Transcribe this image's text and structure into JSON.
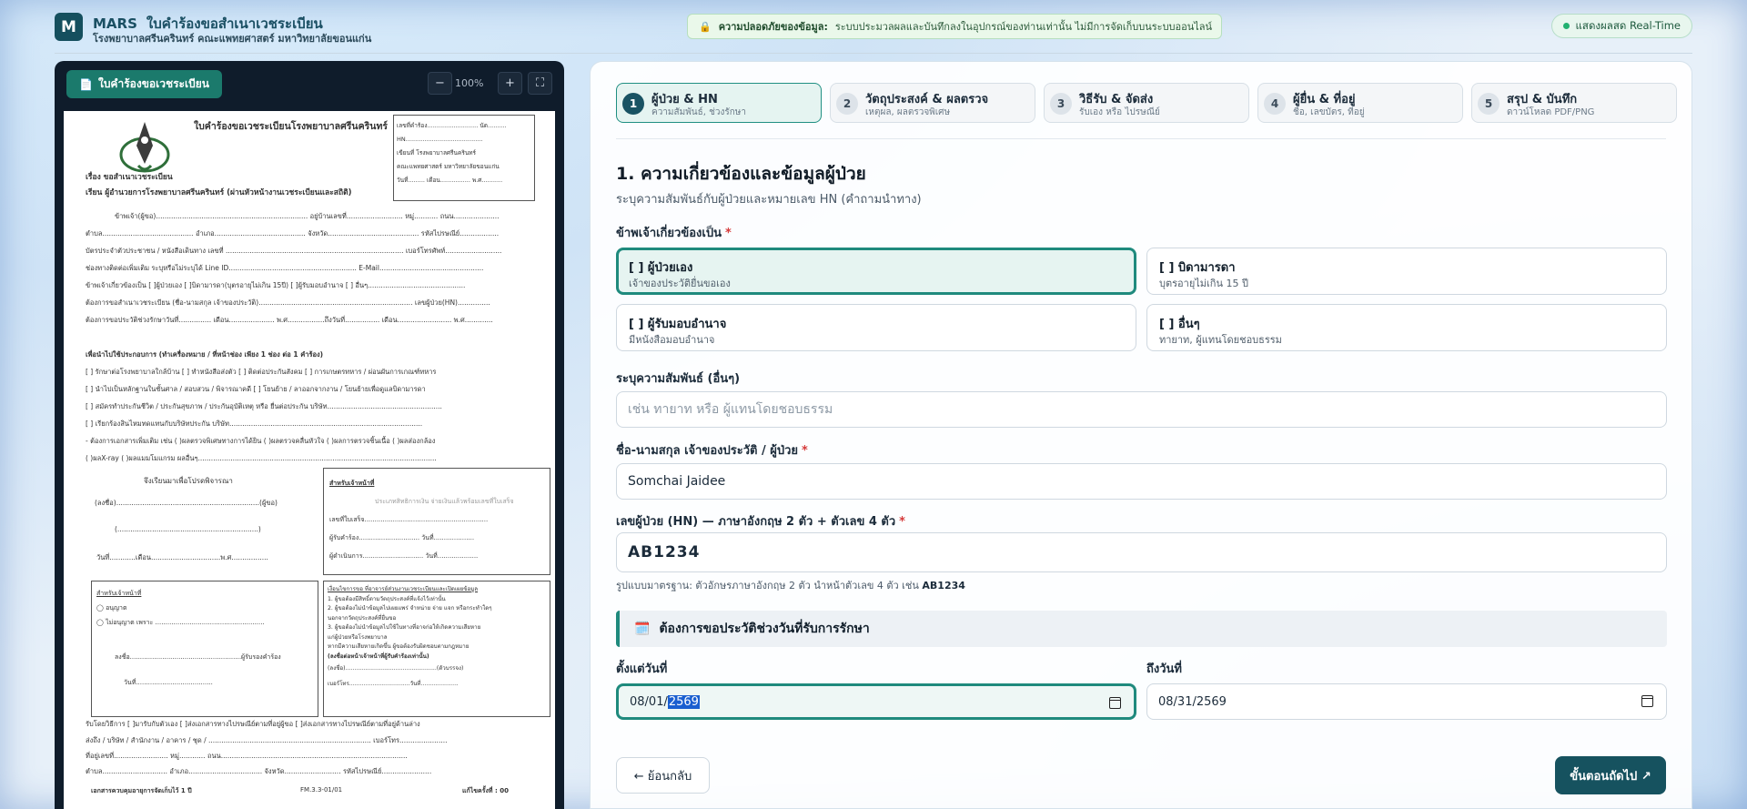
{
  "header": {
    "logo": "M",
    "app_name": "MARS",
    "app_title": "ใบคำร้องขอสำเนาเวชระเบียน",
    "app_sub": "โรงพยาบาลศรีนครินทร์ คณะแพทยศาสตร์ มหาวิทยาลัยขอนแก่น",
    "privacy_title": "ความปลอดภัยของข้อมูล:",
    "privacy_text": "ระบบประมวลผลและบันทึกลงในอุปกรณ์ของท่านเท่านั้น ไม่มีการจัดเก็บบนระบบออนไลน์",
    "realtime": "แสดงผลสด Real-Time",
    "accent": "#1f8a7d",
    "brand": "#16525f"
  },
  "preview": {
    "form_button": "ใบคำร้องขอเวชระเบียน",
    "zoom_out": "−",
    "zoom_level": "100%",
    "zoom_in": "+",
    "fullscreen": "⛶",
    "doc": {
      "heading": "ใบคำร้องขอเวชระเบียนโรงพยาบาลศรีนครินทร์",
      "box_lines": [
        "เลขที่คำร้อง........................... นัด..........",
        "HN.........................................",
        "เขียนที่  โรงพยาบาลศรีนครินทร์",
        "คณะแพทยศาสตร์ มหาวิทยาลัยขอนแก่น",
        "วันที่......... เดือน................ พ.ศ..........."
      ],
      "subject": "เรื่อง      ขอสำเนาเวชระเบียน",
      "to": "เรียน      ผู้อำนวยการโรงพยาบาลศรีนครินทร์ (ผ่านหัวหน้างานเวชระเบียนและสถิติ)",
      "lines": [
        "ข้าพเจ้า(ผู้ขอ)...................................................................... อยู่บ้านเลขที่.......................... หมู่........... ถนน.....................",
        "ตำบล.......................................... อำเภอ.......................................... จังหวัด.......................................... รหัสไปรษณีย์..................",
        "บัตรประจำตัวประชาชน / หนังสือเดินทาง เลขที่ .................................................................................. เบอร์โทรศัพท์..........................",
        "ช่องทางติดต่อเพิ่มเติม ระบุหรือไม่ระบุได้ Line ID........................................................... E-Mail................................................",
        "ข้าพเจ้าเกี่ยวข้องเป็น  [ ]ผู้ป่วยเอง  [ ]บิดามารดา(บุตรอายุไม่เกิน 15ปี)  [ ]ผู้รับมอบอำนาจ  [ ] อื่นๆ.............................................",
        "ต้องการขอสำเนาเวชระเบียน (ชื่อ-นามสกุล เจ้าของประวัติ)....................................................................... เลขผู้ป่วย(HN)...............",
        "ต้องการขอประวัติช่วงรักษาวันที่............... เดือน..................... พ.ศ.................ถึงวันที่................ เดือน......................... พ.ศ.............",
        "เพื่อนำไปใช้ประกอบการ (ทำเครื่องหมาย /  ที่หน้าช่อง เพียง 1 ช่อง ต่อ 1 คำร้อง)",
        "[ ] รักษาต่อโรงพยาบาลใกล้บ้าน   [ ] ทำหนังสือส่งตัว   [ ] ติดต่อประกันสังคม   [ ] การเกษตรทหาร / ผ่อนผันการเกณฑ์ทหาร",
        "[ ] นำไปเป็นหลักฐานในชั้นศาล / สอบสวน / พิจารณาคดี   [ ] โยนย้าย / ลาออกจากงาน / โยนย้ายเพื่อดูแลบิดามารดา",
        "[ ] สมัครทำประกันชีวิต / ประกันสุขภาพ / ประกันอุบัติเหตุ หรือ ยื่นต่อประกัน บริษัท.....................................................",
        "[ ] เรียกร้องสินไหมทดแทนกับบริษัทประกัน บริษัท.........................................................................................",
        " - ต้องการเอกสารเพิ่มเติม เช่น ( )ผลตรวจพิเศษทางการได้ยิน ( )ผลตรวจคลื่นหัวใจ ( )ผลการตรวจชิ้นเนื้อ ( )ผลส่องกล้อง",
        "( )ผลX-ray ( )ผลแมมโมแกรม ผลอื่นๆ.............................................................................................................."
      ],
      "sign_intro": "จึงเรียนมาเพื่อโปรดพิจารณา",
      "sign_line": "(ลงชื่อ)..................................................................(ผู้ขอ)",
      "paren_line": "(.................................................................)",
      "date_line": "วันที่............เดือน................................พ.ศ.................",
      "officer_title": "สำหรับเจ้าหน้าที่",
      "officer_cols": "ประเภทสิทธิการเงิน   จ่ายเงินแล้วพร้อมเลขที่ใบเสร็จ",
      "officer_lines": [
        "เลขที่ใบเสร็จ.............................................................",
        "ผู้รับคำร้อง.............................. วันที่....................",
        "ผู้ดำเนินการ.............................. วันที่...................."
      ],
      "officer2_title": "สำหรับเจ้าหน้าที่",
      "officer2_opts": [
        "อนุญาต",
        "ไม่อนุญาต เพราะ ......................................................"
      ],
      "officer2_sign": "ลงชื่อ.......................................................ผู้รับรองคำร้อง",
      "officer2_date": "วันที่......................................",
      "notes_title": "เงื่อนไขการขอ ที่อาจารย์ส่วนงานเวชระเบียนและเปิดเผยข้อมูล",
      "notes": [
        "1. ผู้ขอต้องมีสิทธิ์ตามวัตถุประสงค์ที่แจ้งไว้เท่านั้น",
        "2. ผู้ขอต้องไม่นำข้อมูลไปเผยแพร่ จำหน่าย จ่าย แจก หรือกระทำใดๆ",
        "   นอกจากวัตถุประสงค์ที่ยื่นขอ",
        "3. ผู้ขอต้องไม่นำข้อมูลไปใช้ในทางที่อาจก่อให้เกิดความเสียหาย",
        "   แก่ผู้ป่วยหรือโรงพยาบาล",
        "   หากมีความเสียหายเกิดขึ้น ผู้ขอต้องรับผิดชอบตามกฎหมาย"
      ],
      "notes_sign_title": "(ลงชื่อต่อหน้าเจ้าหน้าที่ผู้รับคำร้องเท่านั้น)",
      "notes_sign": "(ลงชื่อ)...................................................(ตัวบรรจง)",
      "notes_phone": "เบอร์โทร..................................วันที่.....................",
      "receive": "รับโดยวิธีการ       [ ]มารับกับตัวเอง   [ ]ส่งเอกสารทางไปรษณีย์ตามที่อยู่ผู้ขอ   [ ]ส่งเอกสารทางไปรษณีย์ตามที่อยู่ด้านล่าง",
      "addr1": "ส่งถึง / บริษัท / สำนักงาน / อาคาร / ชุด / ........................................................................... เบอร์โทร......................",
      "addr2": "ที่อยู่เลขที่......................... หมู่............ ถนน......................................................................................",
      "addr3": "ตำบล.............................. อำเภอ.................................. จังหวัด.......................... รหัสไปรษณีย์.......................",
      "footer_left": "เอกสารควบคุมอายุการจัดเก็บไว้ 1 ปี",
      "footer_mid": "FM.3.3-01/01",
      "footer_right": "แก้ไขครั้งที่ : 00"
    }
  },
  "steps": [
    {
      "num": "1",
      "title": "ผู้ป่วย & HN",
      "sub": "ความสัมพันธ์, ช่วงรักษา"
    },
    {
      "num": "2",
      "title": "วัตถุประสงค์ & ผลตรวจ",
      "sub": "เหตุผล, ผลตรวจพิเศษ"
    },
    {
      "num": "3",
      "title": "วิธีรับ & จัดส่ง",
      "sub": "รับเอง หรือ ไปรษณีย์"
    },
    {
      "num": "4",
      "title": "ผู้ยื่น & ที่อยู่",
      "sub": "ชื่อ, เลขบัตร, ที่อยู่"
    },
    {
      "num": "5",
      "title": "สรุป & บันทึก",
      "sub": "ดาวน์โหลด PDF/PNG"
    }
  ],
  "form": {
    "title": "1. ความเกี่ยวข้องและข้อมูลผู้ป่วย",
    "subtitle": "ระบุความสัมพันธ์กับผู้ป่วยและหมายเลข HN (คำถามนำทาง)",
    "relation_label": "ข้าพเจ้าเกี่ยวข้องเป็น",
    "required_mark": "*",
    "options": [
      {
        "title": "[ ] ผู้ป่วยเอง",
        "sub": "เจ้าของประวัติยื่นขอเอง"
      },
      {
        "title": "[ ] บิดามารดา",
        "sub": "บุตรอายุไม่เกิน 15 ปี"
      },
      {
        "title": "[ ] ผู้รับมอบอำนาจ",
        "sub": "มีหนังสือมอบอำนาจ"
      },
      {
        "title": "[ ] อื่นๆ",
        "sub": "ทายาท, ผู้แทนโดยชอบธรรม"
      }
    ],
    "other_label": "ระบุความสัมพันธ์ (อื่นๆ)",
    "other_placeholder": "เช่น ทายาท หรือ ผู้แทนโดยชอบธรรม",
    "name_label": "ชื่อ-นามสกุล เจ้าของประวัติ / ผู้ป่วย",
    "name_value": "Somchai Jaidee",
    "hn_label": "เลขผู้ป่วย (HN) — ภาษาอังกฤษ 2 ตัว + ตัวเลข 4 ตัว",
    "hn_value": "AB1234",
    "hn_hint": "รูปแบบมาตรฐาน: ตัวอักษรภาษาอังกฤษ 2 ตัว นำหน้าตัวเลข 4 ตัว เช่น",
    "hn_example": "AB1234",
    "period_title": "ต้องการขอประวัติช่วงวันที่รับการรักษา",
    "from_label": "ตั้งแต่วันที่",
    "from_md": "08/01/",
    "from_year": "2569",
    "to_label": "ถึงวันที่",
    "to_value": "08/31/2569",
    "back_button": "← ย้อนกลับ",
    "next_button": "ขั้นตอนถัดไป ↗"
  }
}
